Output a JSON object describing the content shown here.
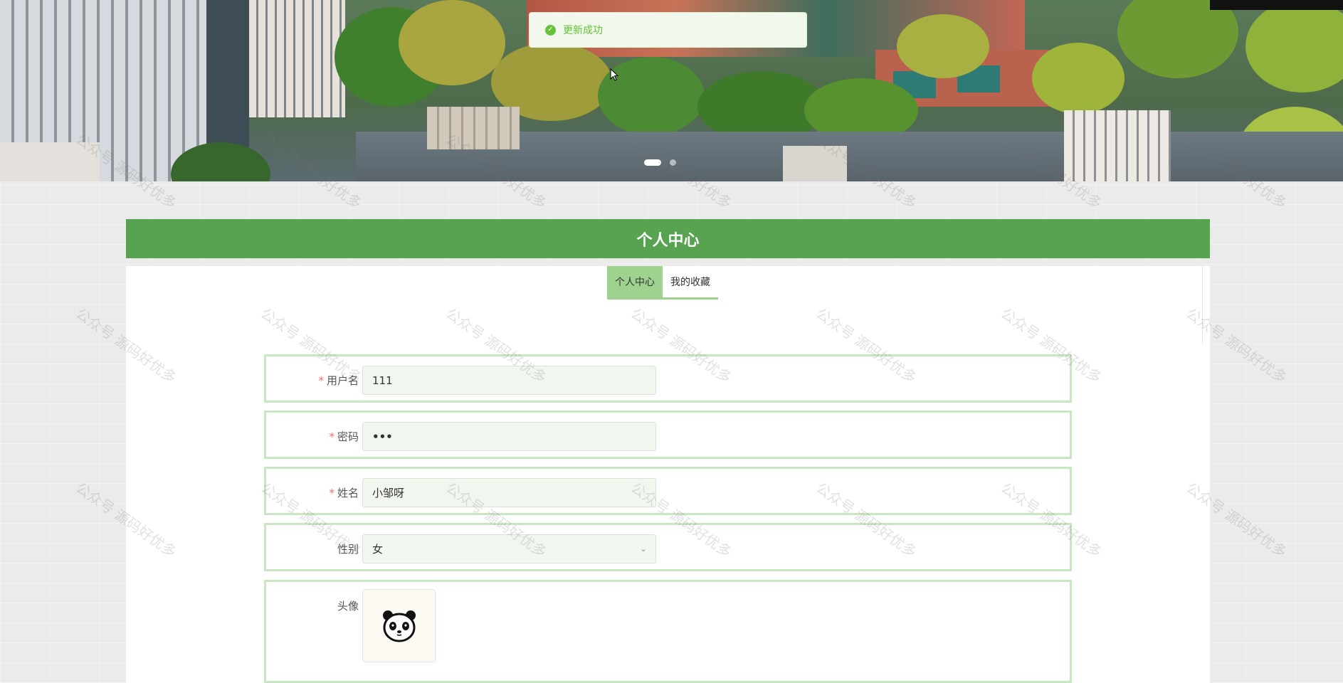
{
  "toast": {
    "message": "更新成功",
    "icon": "check-circle-icon",
    "color": "#67c23a"
  },
  "banner": {
    "slide_count": 2,
    "active_slide": 0
  },
  "header": {
    "title": "个人中心"
  },
  "tabs": [
    {
      "label": "个人中心",
      "active": true
    },
    {
      "label": "我的收藏",
      "active": false
    }
  ],
  "form": {
    "username": {
      "label": "用户名",
      "required": true,
      "value": "111"
    },
    "password": {
      "label": "密码",
      "required": true,
      "value": "•••"
    },
    "name": {
      "label": "姓名",
      "required": true,
      "value": "小邹呀"
    },
    "gender": {
      "label": "性别",
      "required": false,
      "value": "女"
    },
    "avatar": {
      "label": "头像",
      "required": false,
      "icon": "panda-avatar-icon"
    }
  },
  "watermark": {
    "text": "公众号 源码好优多"
  },
  "colors": {
    "accent": "#58a34f",
    "tab_active": "#9dd28f",
    "row_border": "#c8e6c2",
    "required": "#f56c6c"
  }
}
